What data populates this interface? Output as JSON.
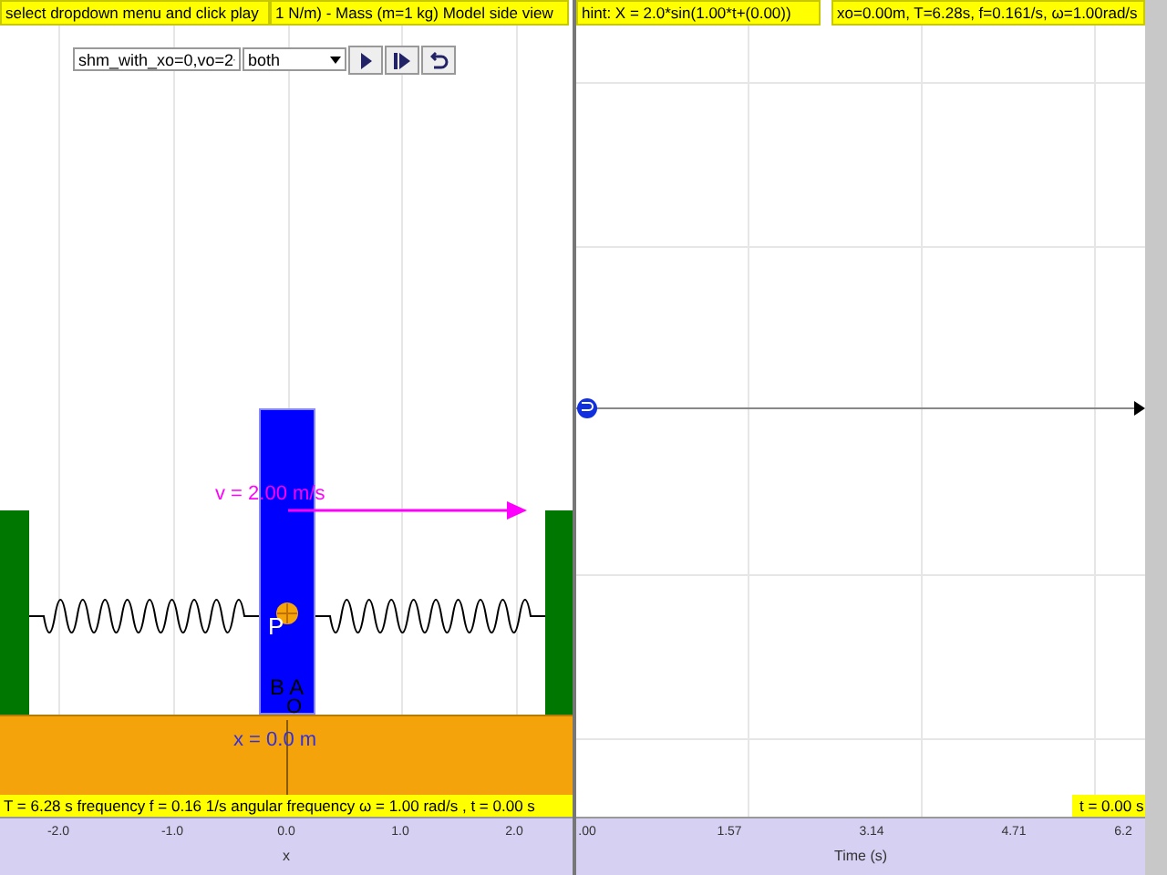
{
  "left_panel": {
    "labels": [
      "select dropdown menu and click play",
      "1 N/m) - Mass (m=1 kg) Model side view"
    ],
    "controls": {
      "selects": [
        "shm_with_xo=0,vo=2",
        "both"
      ],
      "buttons": [
        {
          "kind": "play"
        },
        {
          "kind": "step"
        },
        {
          "kind": "reset"
        }
      ]
    },
    "simulation": {
      "velocity_label": "v = 2.00 m/s",
      "point_label": "P",
      "marker_labels": "B A",
      "origin_label": "O",
      "position_label": "x = 0.0 m"
    },
    "status": "T = 6.28 s frequency f = 0.16 1/s angular frequency ω = 1.00 rad/s , t = 0.00 s",
    "axis": {
      "ticks": [
        "-2.0",
        "-1.0",
        "0.0",
        "1.0",
        "2.0"
      ],
      "label": "x"
    }
  },
  "right_panel": {
    "labels": [
      "hint: X = 2.0*sin(1.00*t+(0.00))",
      "xo=0.00m, T=6.28s, f=0.161/s, ω=1.00rad/s"
    ],
    "time_label": "t = 0.00 s",
    "axis": {
      "ticks": [
        ".00",
        "1.57",
        "3.14",
        "4.71",
        "6.2"
      ],
      "label": "Time (s)"
    }
  }
}
